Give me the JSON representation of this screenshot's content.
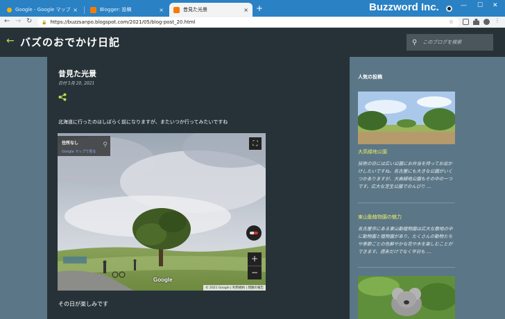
{
  "browser": {
    "tabs": [
      {
        "label": "Google - Google マップ",
        "active": false
      },
      {
        "label": "Blogger: 投稿",
        "active": false
      },
      {
        "label": "昔見た光景",
        "active": true
      }
    ],
    "tab_close_glyph": "×",
    "new_tab_glyph": "+",
    "brand": "Buzzword Inc.",
    "url": "https://buzzsanpo.blogspot.com/2021/05/blog-post_20.html",
    "accent": "#2a81c4"
  },
  "blog": {
    "title": "バズのおでかけ日記",
    "search_placeholder": "このブログを検索",
    "header_bg": "#263238",
    "link_color": "#c6d84b"
  },
  "post": {
    "title": "昔見た光景",
    "date": "日付 5月 20, 2021",
    "body": "北海道に行ったのはしばらく前になりますが、またいつか行ってみたいですね",
    "footer": "その日が楽しみです",
    "streetview": {
      "address": "住所なし",
      "maps_link": "Google マップで見る",
      "logo": "Google",
      "attribution": "© 2021 Google | 利用規約 | 問題の報告"
    }
  },
  "sidebar": {
    "heading": "人気の投稿",
    "items": [
      {
        "title": "大高緑地公園",
        "snippet": "技術の日には広い公園にお弁当を持ってお出かけしたいですね。名古屋にも大きな公園がいくつかありますが、大高緑地公園もその中の一つです。広大な芝生公園でのんびり",
        "more": "…"
      },
      {
        "title": "東山動植物園の魅力",
        "snippet": "名古屋市にある東山動植物園は広大な敷地の中に動物園と植物園があり、たくさんの動物たちや季節ごとの色鮮やかな花や木を楽しむことができます。週末だけでなく平日も",
        "more": "…"
      }
    ]
  }
}
